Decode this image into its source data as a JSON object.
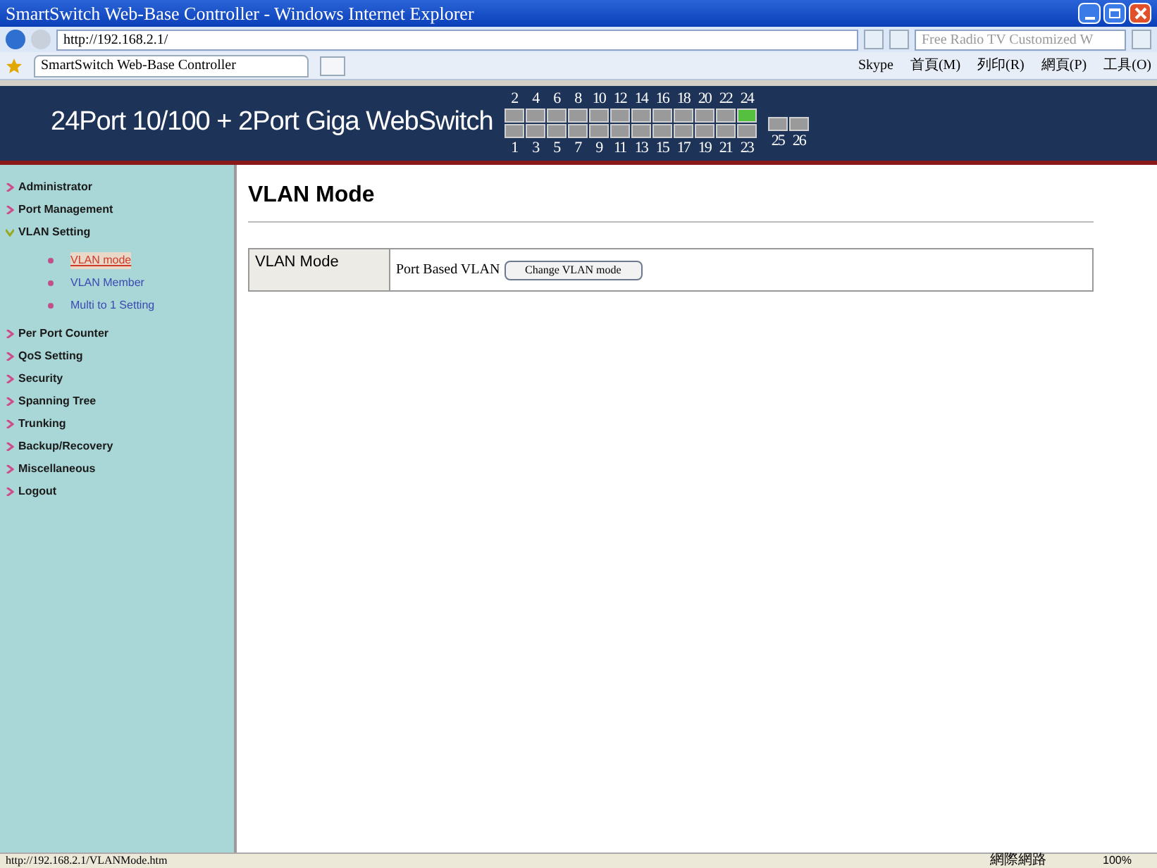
{
  "window": {
    "title": "SmartSwitch Web-Base Controller - Windows Internet Explorer"
  },
  "address_bar": {
    "url": "http://192.168.2.1/"
  },
  "search": {
    "placeholder": "Free Radio TV Customized W"
  },
  "tab": {
    "label": "SmartSwitch Web-Base Controller"
  },
  "toolbar": [
    "Skype",
    "首頁(M)",
    "列印(R)",
    "網頁(P)",
    "工具(O)"
  ],
  "banner": {
    "title": "24Port 10/100 + 2Port Giga WebSwitch",
    "top_ports": [
      {
        "label": "2",
        "on": false
      },
      {
        "label": "4",
        "on": false
      },
      {
        "label": "6",
        "on": false
      },
      {
        "label": "8",
        "on": false
      },
      {
        "label": "10",
        "on": false
      },
      {
        "label": "12",
        "on": false
      },
      {
        "label": "14",
        "on": false
      },
      {
        "label": "16",
        "on": false
      },
      {
        "label": "18",
        "on": false
      },
      {
        "label": "20",
        "on": false
      },
      {
        "label": "22",
        "on": false
      },
      {
        "label": "24",
        "on": true
      }
    ],
    "bottom_ports": [
      {
        "label": "1",
        "on": false
      },
      {
        "label": "3",
        "on": false
      },
      {
        "label": "5",
        "on": false
      },
      {
        "label": "7",
        "on": false
      },
      {
        "label": "9",
        "on": false
      },
      {
        "label": "11",
        "on": false
      },
      {
        "label": "13",
        "on": false
      },
      {
        "label": "15",
        "on": false
      },
      {
        "label": "17",
        "on": false
      },
      {
        "label": "19",
        "on": false
      },
      {
        "label": "21",
        "on": false
      },
      {
        "label": "23",
        "on": false
      }
    ],
    "giga_ports": [
      {
        "label": "25",
        "on": false
      },
      {
        "label": "26",
        "on": false
      }
    ]
  },
  "sidebar": {
    "items": [
      {
        "label": "Administrator",
        "expanded": false
      },
      {
        "label": "Port Management",
        "expanded": false
      },
      {
        "label": "VLAN Setting",
        "expanded": true,
        "children": [
          {
            "label": "VLAN mode",
            "selected": true
          },
          {
            "label": "VLAN Member",
            "selected": false
          },
          {
            "label": "Multi to 1 Setting",
            "selected": false
          }
        ]
      },
      {
        "label": "Per Port Counter",
        "expanded": false
      },
      {
        "label": "QoS Setting",
        "expanded": false
      },
      {
        "label": "Security",
        "expanded": false
      },
      {
        "label": "Spanning Tree",
        "expanded": false
      },
      {
        "label": "Trunking",
        "expanded": false
      },
      {
        "label": "Backup/Recovery",
        "expanded": false
      },
      {
        "label": "Miscellaneous",
        "expanded": false
      },
      {
        "label": "Logout",
        "expanded": false
      }
    ]
  },
  "content": {
    "heading": "VLAN Mode",
    "label": "VLAN Mode",
    "value": "Port Based VLAN",
    "button": "Change VLAN mode"
  },
  "status_bar": {
    "url": "http://192.168.2.1/VLANMode.htm",
    "zone": "網際網路",
    "zoom": "100%"
  }
}
